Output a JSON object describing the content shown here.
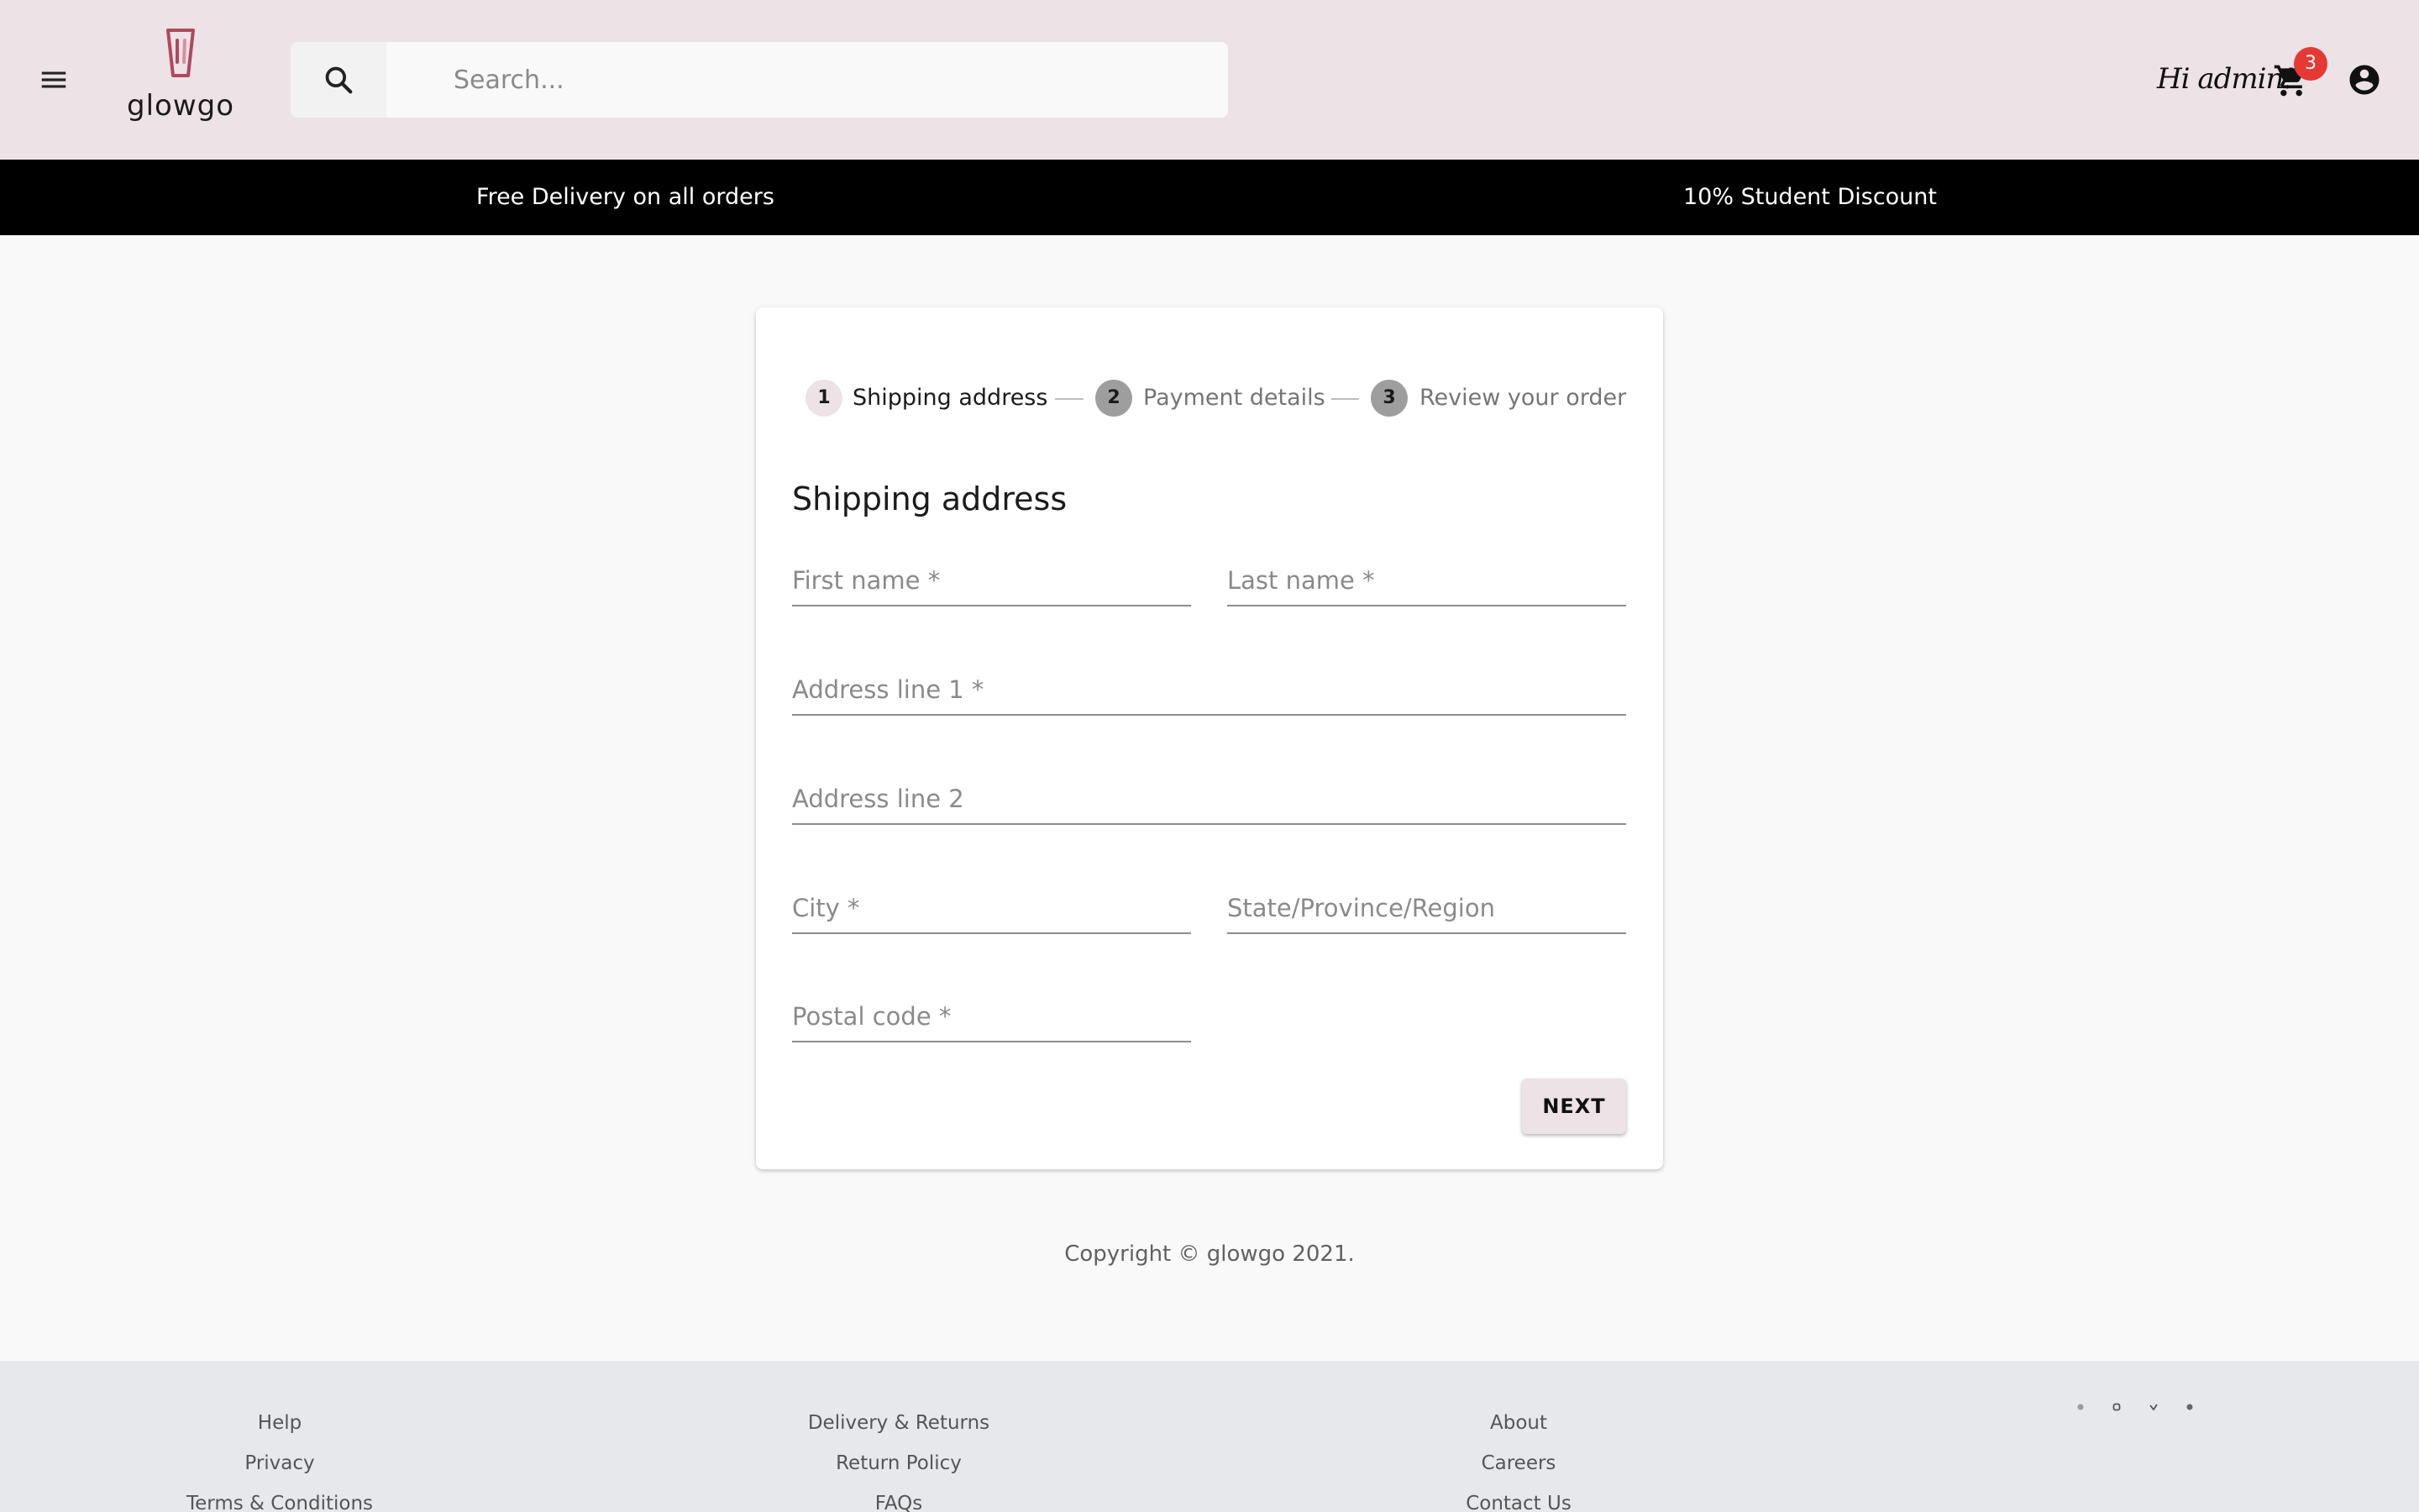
{
  "header": {
    "brand": "glowgo",
    "search": {
      "placeholder": "Search...",
      "value": ""
    },
    "greeting": "Hi admin!",
    "cart_count": "3"
  },
  "promo": {
    "left": "Free Delivery on all orders",
    "right": "10% Student Discount"
  },
  "checkout": {
    "steps": [
      {
        "number": "1",
        "label": "Shipping address",
        "state": "active"
      },
      {
        "number": "2",
        "label": "Payment details",
        "state": "inactive"
      },
      {
        "number": "3",
        "label": "Review your order",
        "state": "inactive"
      }
    ],
    "title": "Shipping address",
    "fields": {
      "first_name": {
        "placeholder": "First name *",
        "value": ""
      },
      "last_name": {
        "placeholder": "Last name *",
        "value": ""
      },
      "address1": {
        "placeholder": "Address line 1 *",
        "value": ""
      },
      "address2": {
        "placeholder": "Address line 2",
        "value": ""
      },
      "city": {
        "placeholder": "City *",
        "value": ""
      },
      "state": {
        "placeholder": "State/Province/Region",
        "value": ""
      },
      "postal": {
        "placeholder": "Postal code *",
        "value": ""
      }
    },
    "next_label": "NEXT"
  },
  "copyright": "Copyright © glowgo 2021.",
  "footer": {
    "col1": [
      "Help",
      "Privacy",
      "Terms & Conditions"
    ],
    "col2": [
      "Delivery & Returns",
      "Return Policy",
      "FAQs"
    ],
    "col3": [
      "About",
      "Careers",
      "Contact Us"
    ],
    "social_icons": [
      "facebook-icon",
      "instagram-icon",
      "twitter-icon",
      "pinterest-icon"
    ]
  },
  "colors": {
    "header_bg": "#ede3e6",
    "promo_bg": "#000000",
    "badge": "#e53935",
    "logo_accent": "#b0485e",
    "footer_bg": "#e7e8ec"
  }
}
